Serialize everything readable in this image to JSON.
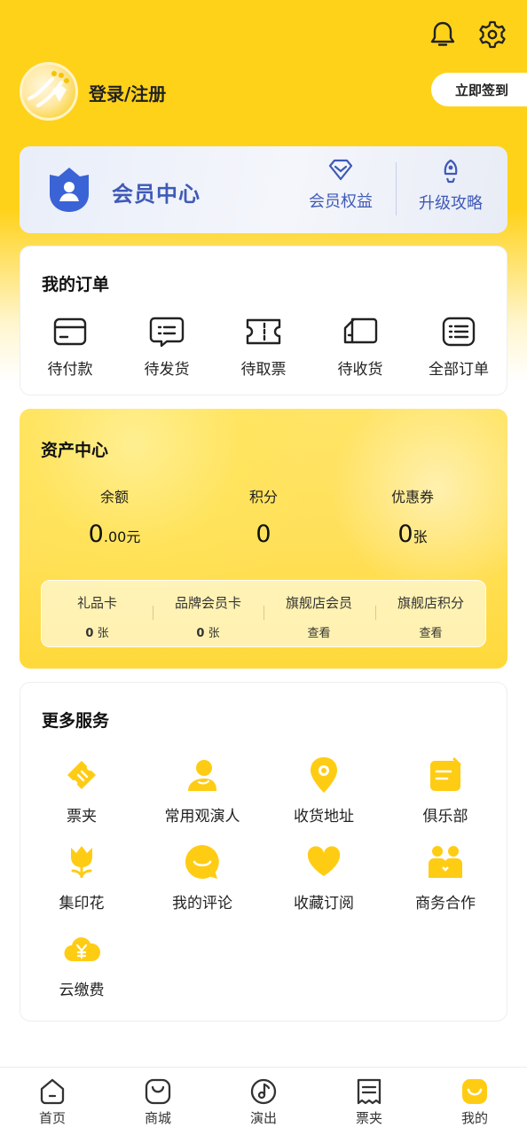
{
  "header": {
    "login_label": "登录/注册",
    "checkin_label": "立即签到",
    "icons": [
      "bell-icon",
      "gear-icon"
    ]
  },
  "member": {
    "title": "会员中心",
    "benefits_label": "会员权益",
    "upgrade_label": "升级攻略",
    "color": "#3f5ab7"
  },
  "orders": {
    "title": "我的订单",
    "items": [
      {
        "label": "待付款",
        "icon": "wallet-card-icon"
      },
      {
        "label": "待发货",
        "icon": "chat-box-icon"
      },
      {
        "label": "待取票",
        "icon": "ticket-icon"
      },
      {
        "label": "待收货",
        "icon": "delivery-truck-icon"
      },
      {
        "label": "全部订单",
        "icon": "list-icon"
      }
    ]
  },
  "assets": {
    "title": "资产中心",
    "balance_label": "余额",
    "balance_int": "0",
    "balance_dec": ".00",
    "balance_unit": "元",
    "points_label": "积分",
    "points_value": "0",
    "coupons_label": "优惠券",
    "coupons_value": "0",
    "coupons_unit": "张",
    "sub": [
      {
        "label": "礼品卡",
        "value": "0",
        "unit": " 张"
      },
      {
        "label": "品牌会员卡",
        "value": "0",
        "unit": " 张"
      },
      {
        "label": "旗舰店会员",
        "value": "",
        "unit": "查看"
      },
      {
        "label": "旗舰店积分",
        "value": "",
        "unit": "查看"
      }
    ]
  },
  "services": {
    "title": "更多服务",
    "items": [
      {
        "label": "票夹",
        "icon": "ticket-icon"
      },
      {
        "label": "常用观演人",
        "icon": "person-icon"
      },
      {
        "label": "收货地址",
        "icon": "location-pin-icon"
      },
      {
        "label": "俱乐部",
        "icon": "club-note-icon"
      },
      {
        "label": "集印花",
        "icon": "flower-icon"
      },
      {
        "label": "我的评论",
        "icon": "comment-icon"
      },
      {
        "label": "收藏订阅",
        "icon": "heart-icon"
      },
      {
        "label": "商务合作",
        "icon": "partners-icon"
      },
      {
        "label": "云缴费",
        "icon": "cloud-yen-icon"
      }
    ]
  },
  "tabbar": {
    "items": [
      {
        "label": "首页",
        "icon": "home-icon"
      },
      {
        "label": "商城",
        "icon": "shop-bag-icon"
      },
      {
        "label": "演出",
        "icon": "music-note-icon"
      },
      {
        "label": "票夹",
        "icon": "ticket-folder-icon"
      },
      {
        "label": "我的",
        "icon": "smiley-icon"
      }
    ],
    "active": "我的"
  },
  "colors": {
    "brand_yellow": "#ffd21a",
    "member_blue": "#3f5ab7"
  }
}
